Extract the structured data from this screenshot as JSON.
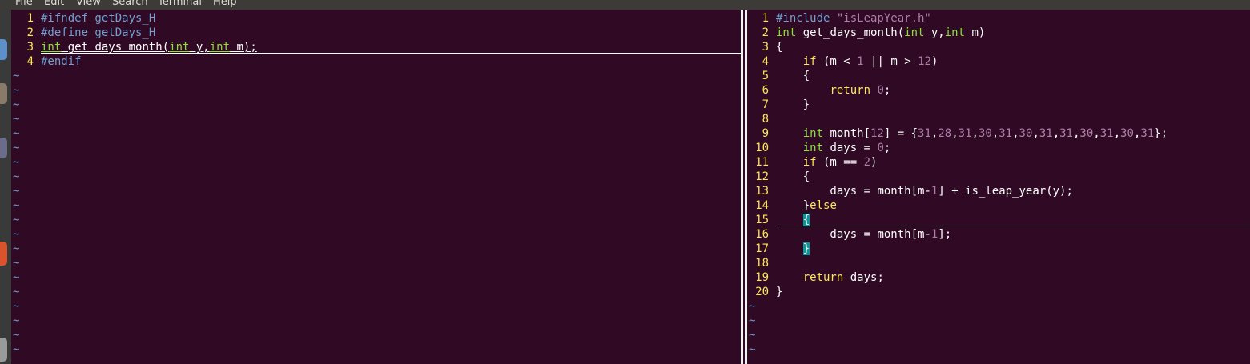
{
  "menubar": {
    "items": [
      "File",
      "Edit",
      "View",
      "Search",
      "Terminal",
      "Help"
    ]
  },
  "left_pane": {
    "lines": [
      {
        "n": "1",
        "tokens": [
          {
            "t": "#ifndef getDays_H",
            "c": "pre"
          }
        ]
      },
      {
        "n": "2",
        "tokens": [
          {
            "t": "#define getDays_H",
            "c": "pre"
          }
        ]
      },
      {
        "n": "3",
        "tokens": [
          {
            "t": "int",
            "c": "type"
          },
          {
            "t": " get_days_month(",
            "c": "plain"
          },
          {
            "t": "int",
            "c": "type"
          },
          {
            "t": " y,",
            "c": "plain"
          },
          {
            "t": "int",
            "c": "type"
          },
          {
            "t": " m);",
            "c": "plain"
          }
        ]
      },
      {
        "n": "4",
        "tokens": [
          {
            "t": "#endif",
            "c": "pre"
          }
        ]
      }
    ],
    "tilde_count": 20
  },
  "right_pane": {
    "lines": [
      {
        "n": "1",
        "tokens": [
          {
            "t": "#include ",
            "c": "pre"
          },
          {
            "t": "\"isLeapYear.h\"",
            "c": "str"
          }
        ]
      },
      {
        "n": "2",
        "tokens": [
          {
            "t": "int",
            "c": "type"
          },
          {
            "t": " get_days_month(",
            "c": "plain"
          },
          {
            "t": "int",
            "c": "type"
          },
          {
            "t": " y,",
            "c": "plain"
          },
          {
            "t": "int",
            "c": "type"
          },
          {
            "t": " m)",
            "c": "plain"
          }
        ]
      },
      {
        "n": "3",
        "tokens": [
          {
            "t": "{",
            "c": "plain"
          }
        ]
      },
      {
        "n": "4",
        "tokens": [
          {
            "t": "    ",
            "c": "plain"
          },
          {
            "t": "if",
            "c": "kw"
          },
          {
            "t": " (m ",
            "c": "plain"
          },
          {
            "t": "<",
            "c": "op"
          },
          {
            "t": " ",
            "c": "plain"
          },
          {
            "t": "1",
            "c": "num"
          },
          {
            "t": " ",
            "c": "plain"
          },
          {
            "t": "||",
            "c": "op"
          },
          {
            "t": " m ",
            "c": "plain"
          },
          {
            "t": ">",
            "c": "op"
          },
          {
            "t": " ",
            "c": "plain"
          },
          {
            "t": "12",
            "c": "num"
          },
          {
            "t": ")",
            "c": "plain"
          }
        ]
      },
      {
        "n": "5",
        "tokens": [
          {
            "t": "    {",
            "c": "plain"
          }
        ]
      },
      {
        "n": "6",
        "tokens": [
          {
            "t": "        ",
            "c": "plain"
          },
          {
            "t": "return",
            "c": "kw"
          },
          {
            "t": " ",
            "c": "plain"
          },
          {
            "t": "0",
            "c": "num"
          },
          {
            "t": ";",
            "c": "plain"
          }
        ]
      },
      {
        "n": "7",
        "tokens": [
          {
            "t": "    }",
            "c": "plain"
          }
        ]
      },
      {
        "n": "8",
        "tokens": []
      },
      {
        "n": "9",
        "tokens": [
          {
            "t": "    ",
            "c": "plain"
          },
          {
            "t": "int",
            "c": "type"
          },
          {
            "t": " month[",
            "c": "plain"
          },
          {
            "t": "12",
            "c": "num"
          },
          {
            "t": "] ",
            "c": "plain"
          },
          {
            "t": "=",
            "c": "op"
          },
          {
            "t": " {",
            "c": "plain"
          },
          {
            "t": "31",
            "c": "num"
          },
          {
            "t": ",",
            "c": "plain"
          },
          {
            "t": "28",
            "c": "num"
          },
          {
            "t": ",",
            "c": "plain"
          },
          {
            "t": "31",
            "c": "num"
          },
          {
            "t": ",",
            "c": "plain"
          },
          {
            "t": "30",
            "c": "num"
          },
          {
            "t": ",",
            "c": "plain"
          },
          {
            "t": "31",
            "c": "num"
          },
          {
            "t": ",",
            "c": "plain"
          },
          {
            "t": "30",
            "c": "num"
          },
          {
            "t": ",",
            "c": "plain"
          },
          {
            "t": "31",
            "c": "num"
          },
          {
            "t": ",",
            "c": "plain"
          },
          {
            "t": "31",
            "c": "num"
          },
          {
            "t": ",",
            "c": "plain"
          },
          {
            "t": "30",
            "c": "num"
          },
          {
            "t": ",",
            "c": "plain"
          },
          {
            "t": "31",
            "c": "num"
          },
          {
            "t": ",",
            "c": "plain"
          },
          {
            "t": "30",
            "c": "num"
          },
          {
            "t": ",",
            "c": "plain"
          },
          {
            "t": "31",
            "c": "num"
          },
          {
            "t": "};",
            "c": "plain"
          }
        ]
      },
      {
        "n": "10",
        "tokens": [
          {
            "t": "    ",
            "c": "plain"
          },
          {
            "t": "int",
            "c": "type"
          },
          {
            "t": " days ",
            "c": "plain"
          },
          {
            "t": "=",
            "c": "op"
          },
          {
            "t": " ",
            "c": "plain"
          },
          {
            "t": "0",
            "c": "num"
          },
          {
            "t": ";",
            "c": "plain"
          }
        ]
      },
      {
        "n": "11",
        "tokens": [
          {
            "t": "    ",
            "c": "plain"
          },
          {
            "t": "if",
            "c": "kw"
          },
          {
            "t": " (m ",
            "c": "plain"
          },
          {
            "t": "==",
            "c": "op"
          },
          {
            "t": " ",
            "c": "plain"
          },
          {
            "t": "2",
            "c": "num"
          },
          {
            "t": ")",
            "c": "plain"
          }
        ]
      },
      {
        "n": "12",
        "tokens": [
          {
            "t": "    {",
            "c": "plain"
          }
        ]
      },
      {
        "n": "13",
        "tokens": [
          {
            "t": "        days ",
            "c": "plain"
          },
          {
            "t": "=",
            "c": "op"
          },
          {
            "t": " month[m",
            "c": "plain"
          },
          {
            "t": "-",
            "c": "op"
          },
          {
            "t": "1",
            "c": "num"
          },
          {
            "t": "] ",
            "c": "plain"
          },
          {
            "t": "+",
            "c": "op"
          },
          {
            "t": " is_leap_year(y);",
            "c": "plain"
          }
        ]
      },
      {
        "n": "14",
        "tokens": [
          {
            "t": "    }",
            "c": "plain"
          },
          {
            "t": "else",
            "c": "kw"
          }
        ]
      },
      {
        "n": "15",
        "tokens": [
          {
            "t": "    ",
            "c": "plain"
          },
          {
            "t": "{",
            "c": "hl"
          }
        ]
      },
      {
        "n": "16",
        "tokens": [
          {
            "t": "        days ",
            "c": "plain"
          },
          {
            "t": "=",
            "c": "op"
          },
          {
            "t": " month[m",
            "c": "plain"
          },
          {
            "t": "-",
            "c": "op"
          },
          {
            "t": "1",
            "c": "num"
          },
          {
            "t": "];",
            "c": "plain"
          }
        ]
      },
      {
        "n": "17",
        "tokens": [
          {
            "t": "    ",
            "c": "plain"
          },
          {
            "t": "}",
            "c": "hl"
          }
        ]
      },
      {
        "n": "18",
        "tokens": []
      },
      {
        "n": "19",
        "tokens": [
          {
            "t": "    ",
            "c": "plain"
          },
          {
            "t": "return",
            "c": "kw"
          },
          {
            "t": " days;",
            "c": "plain"
          }
        ]
      },
      {
        "n": "20",
        "tokens": [
          {
            "t": "}",
            "c": "plain"
          }
        ]
      }
    ],
    "tilde_count": 4
  },
  "tilde_char": "~",
  "colors": {
    "background": "#300a24",
    "line_number": "#fce94f",
    "preprocessor": "#729fcf",
    "type": "#8ae234",
    "keyword": "#fce94f",
    "number": "#ad7fa8",
    "match_paren": "#06989a"
  }
}
